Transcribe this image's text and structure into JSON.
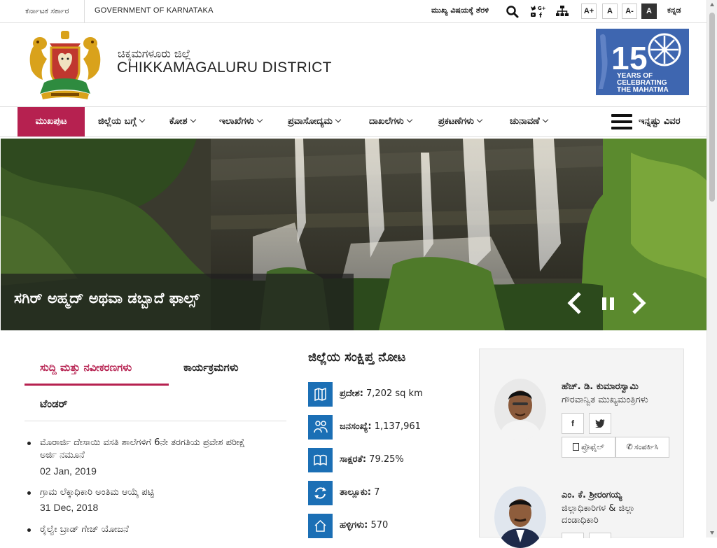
{
  "topbar": {
    "govt_kn": "ಕರ್ನಾಟಕ ಸರ್ಕಾರ",
    "govt_en": "GOVERNMENT OF KARNATAKA",
    "skip_link": "ಮುಖ್ಯ ವಿಷಯಕ್ಕೆ ತೆರಳಿ",
    "font_increase": "A+",
    "font_normal": "A",
    "font_decrease": "A-",
    "contrast": "A",
    "language": "ಕನ್ನಡ",
    "icons": [
      "search-icon",
      "social-media-icon",
      "sitemap-icon"
    ]
  },
  "header": {
    "district_kn": "ಚಿಕ್ಕಮಗಳೂರು ಜಿಲ್ಲೆ",
    "district_en": "CHIKKAMAGALURU DISTRICT",
    "banner": {
      "line1": "YEARS OF",
      "line2": "CELEBRATING",
      "line3": "THE MAHATMA",
      "number": "150"
    }
  },
  "nav": {
    "home": "ಮುಖಪುಟ",
    "items": [
      {
        "label": "ಜಿಲ್ಲೆಯ ಬಗ್ಗೆ"
      },
      {
        "label": "ಕೋಶ"
      },
      {
        "label": "ಇಲಾಖೆಗಳು"
      },
      {
        "label": "ಪ್ರವಾಸೋದ್ಯಮ"
      },
      {
        "label": "ದಾಖಲೆಗಳು"
      },
      {
        "label": "ಪ್ರಕಟಣೆಗಳು"
      },
      {
        "label": "ಚುನಾವಣೆ"
      }
    ],
    "more": "ಇನ್ನಷ್ಟು ವಿವರ"
  },
  "hero": {
    "caption": "ಸಗಿರ್ ಅಹ್ಮದ್ ಅಥವಾ ಡಬ್ಬಾದೆ ಫಾಲ್ಸ್"
  },
  "news": {
    "tabs": [
      "ಸುದ್ದಿ ಮತ್ತು ನವೀಕರಣಗಳು",
      "ಕಾರ್ಯಕ್ರಮಗಳು"
    ],
    "section": "ಟೆಂಡರ್",
    "items": [
      {
        "title": "ಮೊರಾರ್ಜಿ ದೇಸಾಯಿ ವಸತಿ ಶಾಲೆಗಳಿಗೆ 6ನೇ ತರಗತಿಯ ಪ್ರವೇಶ ಪರೀಕ್ಷೆ",
        "title2": "ಅರ್ಜಿ ನಮೂನೆ",
        "date": "02 Jan, 2019"
      },
      {
        "title": "ಗ್ರಾಮ ಲೆಕ್ಕಾಧಿಕಾರಿ ಅಂತಿಮ ಆಯ್ಕೆ ಪಟ್ಟಿ",
        "date": "31 Dec, 2018"
      },
      {
        "title": "ರೈಲ್ವೇ ಬ್ರಾಡ್ ಗೇಜ್ ಯೋಜನೆ"
      }
    ]
  },
  "glance": {
    "title": "ಜಿಲ್ಲೆಯ ಸಂಕ್ಷಿಪ್ತ ನೋಟ",
    "items": [
      {
        "label": "ಪ್ರದೇಶ:",
        "value": "7,202 sq km",
        "icon": "map-icon"
      },
      {
        "label": "ಜನಸಂಖ್ಯೆ:",
        "value": "1,137,961",
        "icon": "people-icon"
      },
      {
        "label": "ಸಾಕ್ಷರತೆ:",
        "value": "79.25%",
        "icon": "book-icon"
      },
      {
        "label": "ತಾಲ್ಲೂಕು:",
        "value": "7",
        "icon": "refresh-icon"
      },
      {
        "label": "ಹಳ್ಳಿಗಳು:",
        "value": "570",
        "icon": "house-icon"
      }
    ]
  },
  "officials": [
    {
      "name": "ಹೆಚ್. ಡಿ. ಕುಮಾರಸ್ವಾಮಿ",
      "role": "ಗೌರವಾನ್ವಿತ ಮುಖ್ಯಮಂತ್ರಿಗಳು",
      "facebook": "f",
      "profile": "ಪ್ರೊಫೈಲ್",
      "contact": "ಸಂಪರ್ಕಿಸಿ"
    },
    {
      "name": "ಎಂ. ಕೆ. ಶ್ರೀರಂಗಯ್ಯ",
      "role1": "ಜಿಲ್ಲಾಧಿಕಾರಿಗಳ & ಜಿಲ್ಲಾ",
      "role2": "ದಂಡಾಧಿಕಾರಿ"
    }
  ],
  "colors": {
    "accent": "#b62150",
    "icon_blue": "#1b6fb5",
    "banner_blue": "#3e66b0"
  }
}
